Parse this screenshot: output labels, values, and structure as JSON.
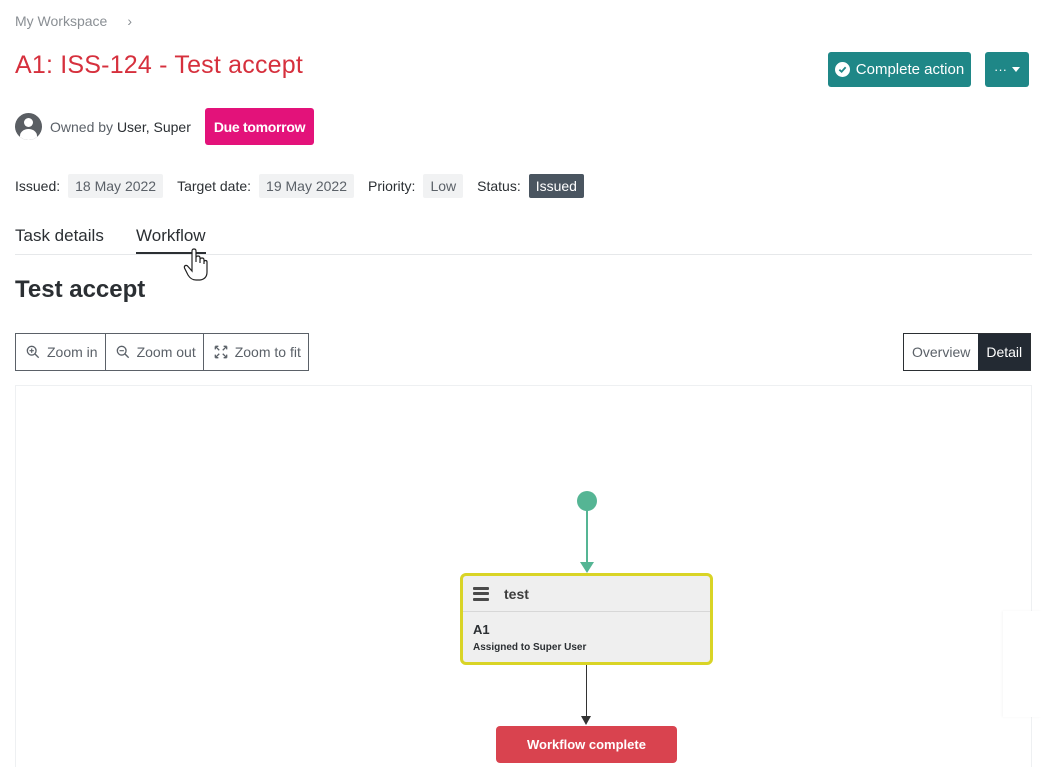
{
  "breadcrumb": {
    "workspace": "My Workspace",
    "separator": "›"
  },
  "header": {
    "title": "A1: ISS-124 - Test accept",
    "complete_action_label": "Complete action",
    "more_label": "···"
  },
  "owner": {
    "prefix": "Owned by",
    "name": "User, Super",
    "due_badge": "Due tomorrow"
  },
  "meta": {
    "issued_label": "Issued:",
    "issued_value": "18 May 2022",
    "target_label": "Target date:",
    "target_value": "19 May 2022",
    "priority_label": "Priority:",
    "priority_value": "Low",
    "status_label": "Status:",
    "status_value": "Issued"
  },
  "tabs": [
    {
      "label": "Task details",
      "active": false
    },
    {
      "label": "Workflow",
      "active": true
    }
  ],
  "section_title": "Test accept",
  "toolbar": {
    "zoom_in": "Zoom in",
    "zoom_out": "Zoom out",
    "zoom_fit": "Zoom to fit",
    "view_overview": "Overview",
    "view_detail": "Detail"
  },
  "workflow": {
    "node_title": "test",
    "node_code": "A1",
    "node_assigned": "Assigned to Super User",
    "end_label": "Workflow complete"
  },
  "colors": {
    "brand_teal": "#1f8787",
    "title_red": "#d6303d",
    "due_pink": "#e3127a",
    "start_green": "#55b594",
    "node_border": "#d9d426",
    "end_red": "#d9434f"
  }
}
